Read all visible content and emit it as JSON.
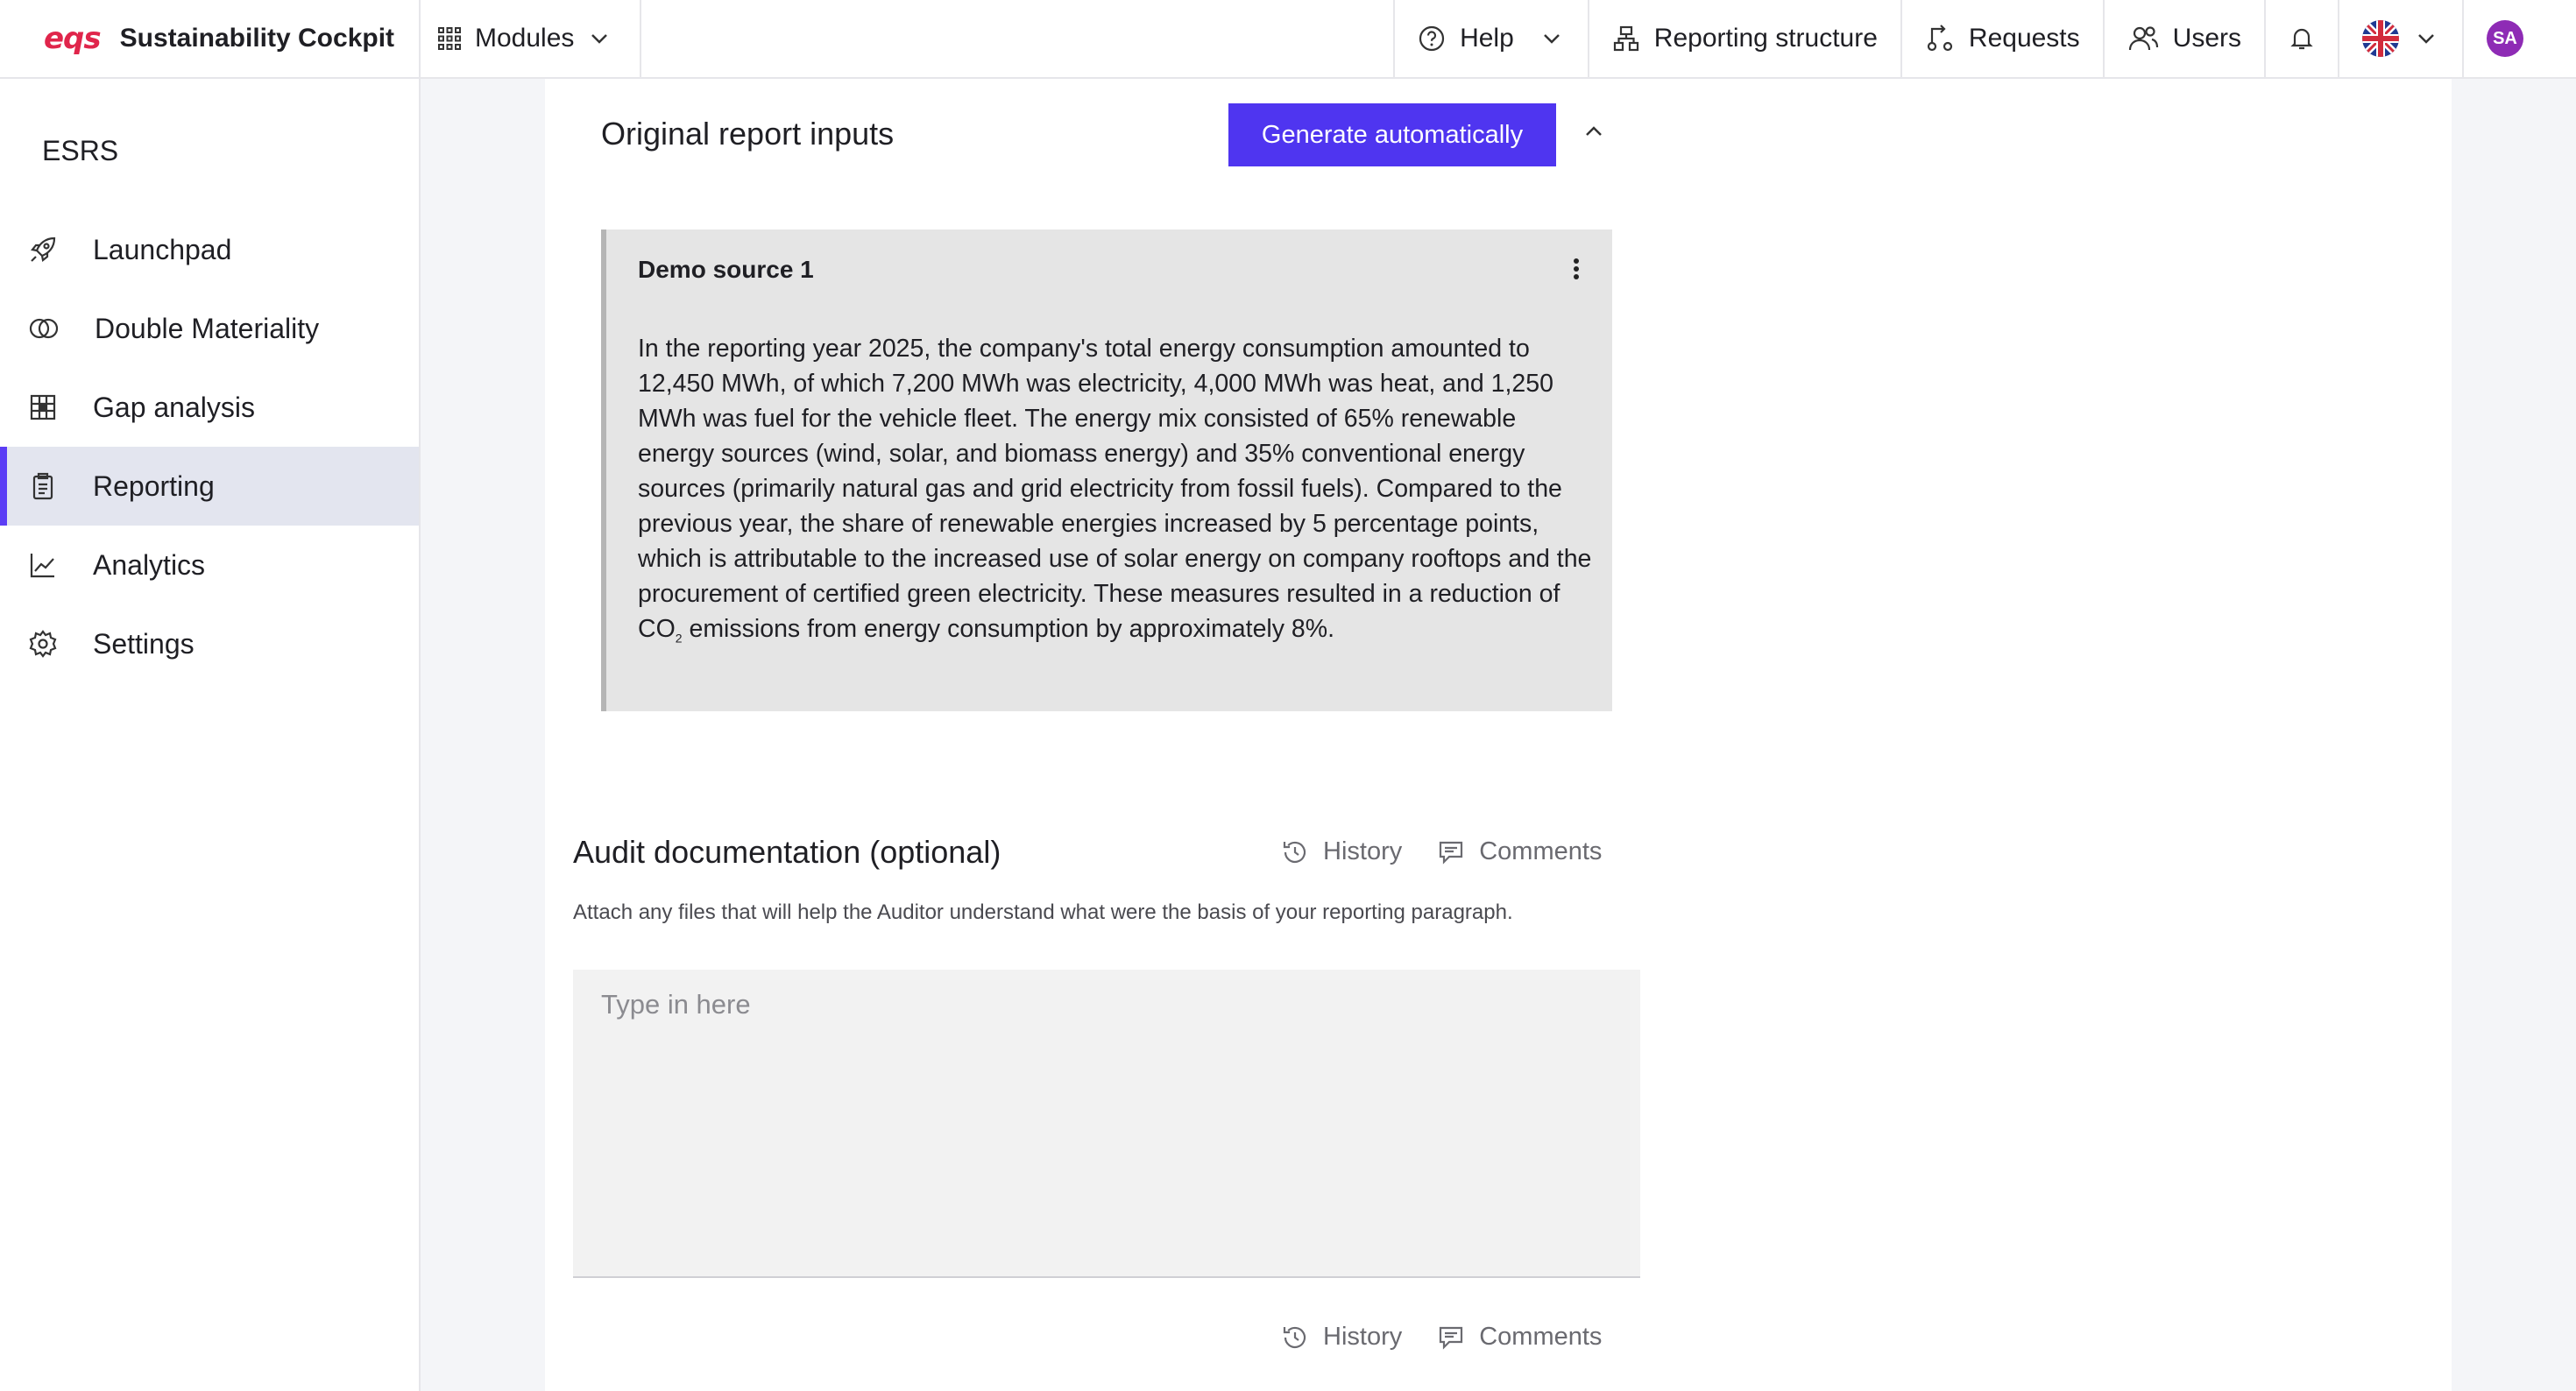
{
  "header": {
    "logo": "eqs",
    "app_title": "Sustainability Cockpit",
    "modules_label": "Modules",
    "help_label": "Help",
    "reporting_structure_label": "Reporting structure",
    "requests_label": "Requests",
    "users_label": "Users",
    "avatar_initials": "SA"
  },
  "sidebar": {
    "heading": "ESRS",
    "items": [
      {
        "label": "Launchpad",
        "icon": "rocket-icon"
      },
      {
        "label": "Double Materiality",
        "icon": "overlap-circles-icon"
      },
      {
        "label": "Gap analysis",
        "icon": "grid-icon"
      },
      {
        "label": "Reporting",
        "icon": "clipboard-icon",
        "active": true
      },
      {
        "label": "Analytics",
        "icon": "line-chart-icon"
      },
      {
        "label": "Settings",
        "icon": "gear-icon"
      }
    ]
  },
  "report_inputs": {
    "title": "Original report inputs",
    "generate_label": "Generate automatically",
    "source": {
      "name": "Demo source 1",
      "text_before_sub": "In the reporting year 2025, the company's total energy consumption amounted to 12,450 MWh, of which 7,200 MWh was electricity, 4,000 MWh was heat, and 1,250 MWh was fuel for the vehicle fleet. The energy mix consisted of 65% renewable energy sources (wind, solar, and biomass energy) and 35% conventional energy sources (primarily natural gas and grid electricity from fossil fuels). Compared to the previous year, the share of renewable energies increased by 5 percentage points, which is attributable to the increased use of solar energy on company rooftops and the procurement of certified green electricity. These measures resulted in a reduction of CO",
      "subscript": "2",
      "text_after_sub": " emissions from energy consumption by approximately 8%."
    }
  },
  "audit": {
    "title": "Audit documentation (optional)",
    "history_label": "History",
    "comments_label": "Comments",
    "description": "Attach any files that will help the Auditor understand what were the basis of your reporting paragraph.",
    "placeholder": "Type in here"
  },
  "colors": {
    "accent": "#4f35f0",
    "brand": "#e0254b",
    "avatar": "#8e2bb5"
  }
}
